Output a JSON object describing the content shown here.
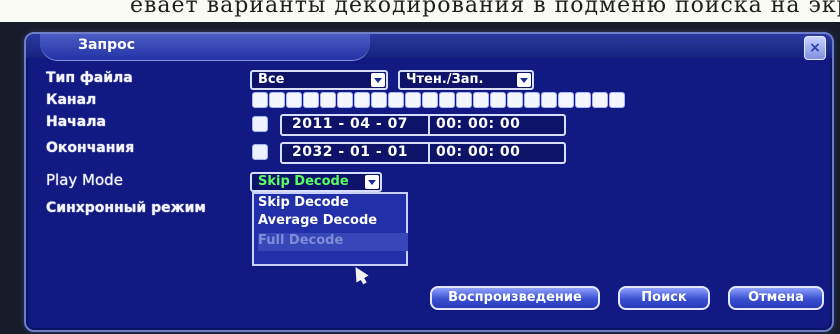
{
  "caption_strip": "евает варианты декодирования в подменю поиска на экране",
  "dialog": {
    "title": "Запрос",
    "close_icon": "close-icon"
  },
  "form": {
    "file_type_label": "Тип файла",
    "file_type_value": "Все",
    "rw_value": "Чтен./Зап.",
    "channel_label": "Канал",
    "channel_count": 16,
    "start_label": "Начала",
    "start_date": "2011 - 04 - 07",
    "start_time": "00: 00: 00",
    "end_label": "Окончания",
    "end_date": "2032 - 01 - 01",
    "end_time": "00: 00: 00",
    "play_mode_label": "Play Mode",
    "play_mode_value": "Skip Decode",
    "sync_label": "Синхронный режим"
  },
  "dropdown": {
    "options": [
      "Skip Decode",
      "Average Decode",
      "Full Decode"
    ],
    "highlighted_color": "#7f8dd8"
  },
  "buttons": {
    "play": "Воспроизведение",
    "search": "Поиск",
    "cancel": "Отмена"
  },
  "colors": {
    "dialog_bg": "#101a82",
    "accent": "#58ff62"
  }
}
